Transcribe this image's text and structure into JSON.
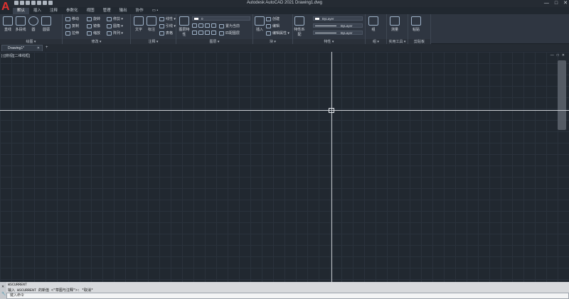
{
  "app": {
    "logo_letter": "A",
    "title": "Autodesk AutoCAD 2021    Drawing1.dwg",
    "window_controls": [
      "—",
      "□",
      "✕"
    ]
  },
  "ribbon_tabs": [
    "默认",
    "插入",
    "注释",
    "参数化",
    "视图",
    "管理",
    "输出",
    "协作",
    "▭ •"
  ],
  "panels": {
    "draw": {
      "title": "绘图 ▾",
      "tools": [
        "直线",
        "多段线",
        "圆",
        "圆弧"
      ]
    },
    "modify": {
      "title": "修改 ▾",
      "tools": [
        "移动",
        "旋转",
        "修剪 ▾",
        "复制",
        "镜像",
        "圆角 ▾",
        "拉伸",
        "缩放",
        "阵列 ▾"
      ]
    },
    "annotation": {
      "title": "注释 ▾",
      "tools": [
        "文字",
        "标注",
        "线性 ▾",
        "引线 ▾",
        "表格"
      ]
    },
    "layers": {
      "title": "图层 ▾",
      "tools": [
        "图层特性",
        "置为当前",
        "匹配图层"
      ],
      "layer_value": "0"
    },
    "block": {
      "title": "块 ▾",
      "tools": [
        "插入",
        "创建",
        "编辑",
        "编辑属性 ▾"
      ]
    },
    "properties": {
      "title": "特性 ▾",
      "tools": [
        "特性匹配"
      ],
      "color": "ByLayer",
      "linetype": "ByLayer",
      "lineweight": "ByLayer"
    },
    "groups": {
      "title": "组 ▾",
      "tools": [
        "组"
      ]
    },
    "utilities": {
      "title": "实用工具 ▾",
      "tools": [
        "测量"
      ]
    },
    "clipboard": {
      "title": "剪贴板",
      "tools": [
        "粘贴"
      ]
    }
  },
  "document_tabs": {
    "active": "Drawing1*",
    "close": "✕",
    "new": "+"
  },
  "viewport": {
    "label": "[-][俯视][二维线框]",
    "controls": [
      "—",
      "□",
      "✕"
    ]
  },
  "command": {
    "history_1": "WSCURRENT",
    "history_2": "输入 WSCURRENT 的新值 <\"草图与注释\">: *取消*",
    "placeholder": "键入命令",
    "side_close": "✕",
    "side_tool": "🔧"
  },
  "colors": {
    "canvas": "#212830",
    "ribbon": "#2f3641",
    "logo": "#e0322f"
  }
}
